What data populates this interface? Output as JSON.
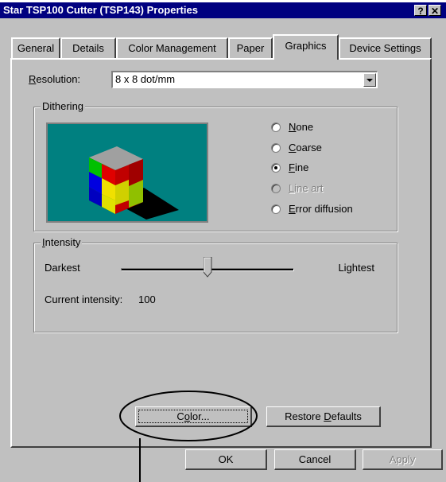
{
  "window": {
    "title": "Star TSP100 Cutter (TSP143) Properties",
    "help_label": "?",
    "close_label": "✕"
  },
  "tabs": [
    {
      "label": "General"
    },
    {
      "label": "Details"
    },
    {
      "label": "Color Management"
    },
    {
      "label": "Paper"
    },
    {
      "label": "Graphics",
      "active": true
    },
    {
      "label": "Device Settings"
    }
  ],
  "resolution": {
    "label_prefix": "R",
    "label_rest": "esolution:",
    "value": "8 x 8 dot/mm"
  },
  "dithering": {
    "title": "Dithering",
    "options": [
      {
        "hotkey": "N",
        "rest": "one",
        "selected": false,
        "disabled": false
      },
      {
        "hotkey": "C",
        "rest": "oarse",
        "selected": false,
        "disabled": false
      },
      {
        "hotkey": "F",
        "rest": "ine",
        "selected": true,
        "disabled": false
      },
      {
        "hotkey": "L",
        "rest": "ine art",
        "selected": false,
        "disabled": true
      },
      {
        "hotkey": "E",
        "rest": "rror diffusion",
        "selected": false,
        "disabled": false
      }
    ]
  },
  "intensity": {
    "title_hotkey": "I",
    "title_rest": "ntensity",
    "left_label": "Darkest",
    "right_label": "Lightest",
    "current_label": "Current intensity:",
    "value": 100,
    "slider_fraction": 0.5
  },
  "buttons": {
    "color": {
      "hotkey": "o",
      "pre": "C",
      "post": "lor..."
    },
    "restore": {
      "pre": "Restore ",
      "hotkey": "D",
      "post": "efaults"
    },
    "ok": "OK",
    "cancel": "Cancel",
    "apply": "Apply"
  }
}
